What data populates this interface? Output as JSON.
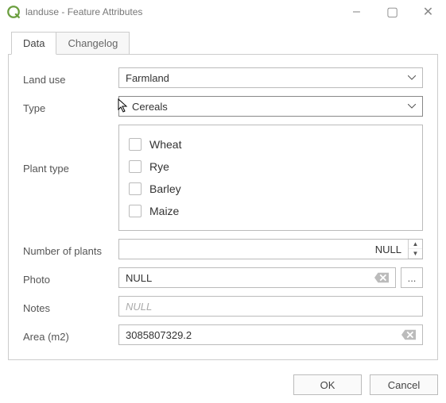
{
  "window": {
    "title": "landuse - Feature Attributes",
    "buttons": {
      "min": "–",
      "max": "▢",
      "close": "✕"
    }
  },
  "tabs": {
    "data": "Data",
    "changelog": "Changelog"
  },
  "fields": {
    "landuse": {
      "label": "Land use",
      "value": "Farmland"
    },
    "type": {
      "label": "Type",
      "value": "Cereals"
    },
    "plant": {
      "label": "Plant type",
      "options": [
        "Wheat",
        "Rye",
        "Barley",
        "Maize"
      ]
    },
    "numplants": {
      "label": "Number of plants",
      "value": "NULL"
    },
    "photo": {
      "label": "Photo",
      "value": "NULL",
      "browse": "..."
    },
    "notes": {
      "label": "Notes",
      "placeholder": "NULL"
    },
    "area": {
      "label": "Area (m2)",
      "value": "3085807329.2"
    }
  },
  "footer": {
    "ok": "OK",
    "cancel": "Cancel"
  }
}
